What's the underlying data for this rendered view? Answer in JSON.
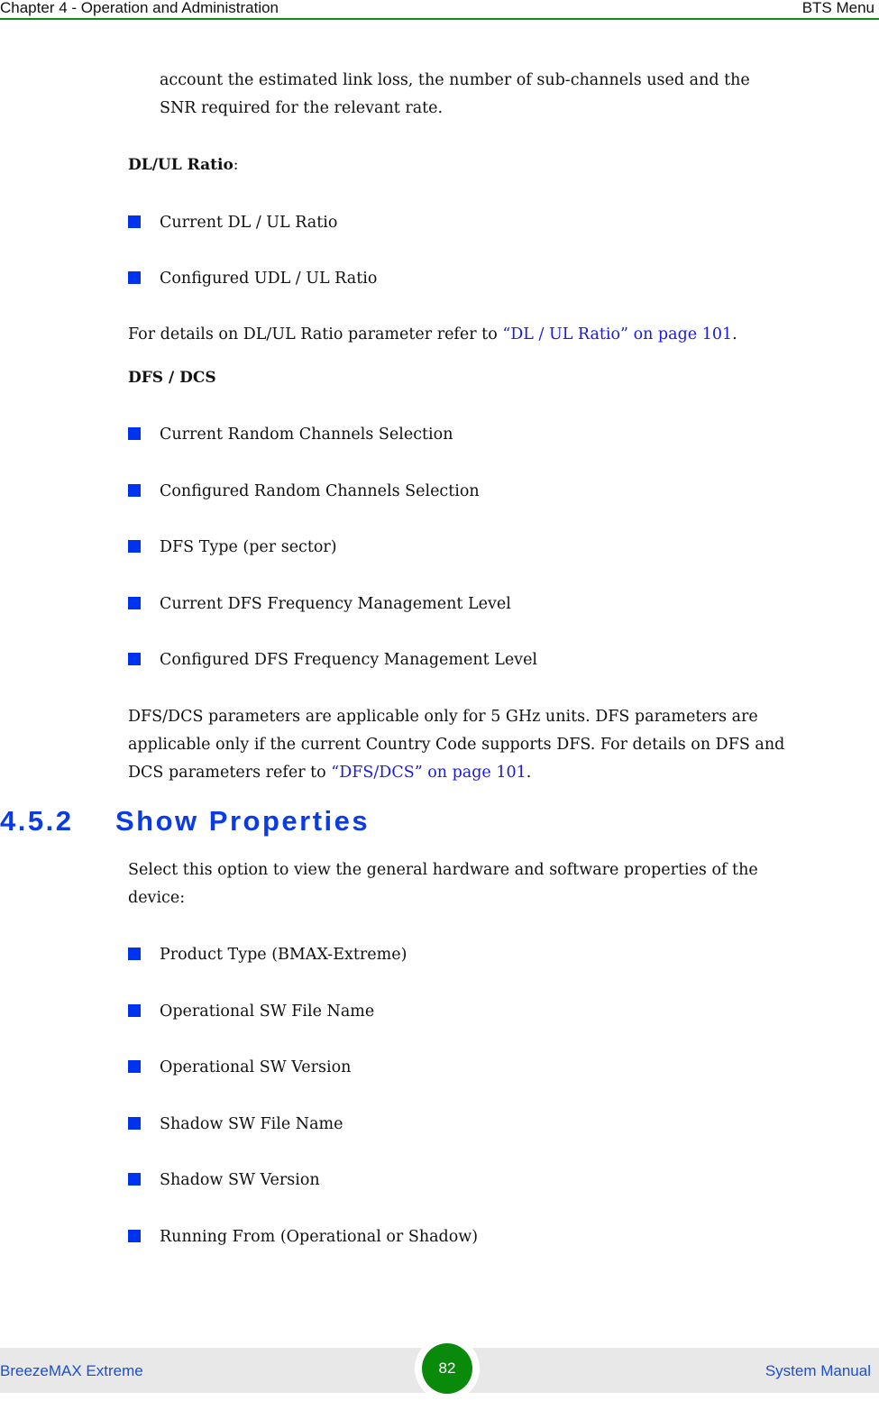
{
  "header": {
    "chapter": "Chapter 4 - Operation and Administration",
    "section": "BTS Menu",
    "rule_color": "#138a13"
  },
  "intro": {
    "line1": "account the estimated link loss, the number of sub-channels used and the",
    "line2": "SNR required for the relevant rate."
  },
  "dlul": {
    "heading": "DL/UL Ratio",
    "heading_suffix": ":",
    "items": [
      "Current DL / UL Ratio",
      "Configured UDL / UL Ratio"
    ],
    "ref_text": "For details on DL/UL Ratio parameter refer to ",
    "ref_link": "“DL / UL Ratio” on page 101",
    "ref_end": "."
  },
  "dfs": {
    "heading": "DFS / DCS",
    "items": [
      "Current Random Channels Selection",
      "Configured Random Channels Selection",
      "DFS Type (per sector)",
      "Current DFS Frequency Management Level",
      "Configured DFS Frequency Management Level"
    ],
    "note_line1": "DFS/DCS parameters are applicable only for 5 GHz units. DFS parameters are",
    "note_line2": "applicable only if the current Country Code supports DFS. For details on DFS and",
    "note_line3_text": "DCS parameters refer to ",
    "note_line3_link": "“DFS/DCS” on page 101",
    "note_line3_end": "."
  },
  "section": {
    "number": "4.5.2",
    "title": "Show Properties",
    "desc_line1": "Select this option to view the general hardware and software properties of the",
    "desc_line2": "device:",
    "items": [
      "Product Type (BMAX-Extreme)",
      "Operational SW File Name",
      "Operational SW Version",
      "Shadow SW File Name",
      "Shadow SW Version",
      "Running From (Operational or Shadow)"
    ]
  },
  "footer": {
    "product": "BreezeMAX Extreme",
    "page_number": "82",
    "doc_type": "System Manual",
    "badge_color": "#0a8a0a",
    "text_color": "#1a4fd0"
  },
  "colors": {
    "bullet": "#0033ee",
    "link": "#1a1adc",
    "section_title": "#0a3be6"
  }
}
